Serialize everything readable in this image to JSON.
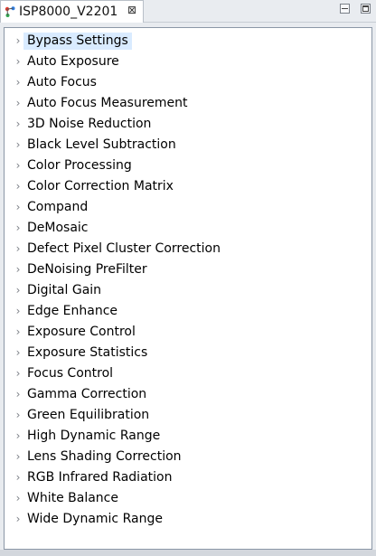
{
  "tab": {
    "title": "ISP8000_V2201",
    "close_glyph": "⊠",
    "icon": "tree-nodes-icon"
  },
  "view_controls": {
    "minimize_icon": "minimize-icon",
    "maximize_icon": "maximize-icon"
  },
  "tree": {
    "selected_index": 0,
    "items": [
      {
        "label": "Bypass Settings"
      },
      {
        "label": "Auto Exposure"
      },
      {
        "label": "Auto Focus"
      },
      {
        "label": "Auto Focus Measurement"
      },
      {
        "label": "3D Noise Reduction"
      },
      {
        "label": "Black Level Subtraction"
      },
      {
        "label": "Color Processing"
      },
      {
        "label": "Color Correction Matrix"
      },
      {
        "label": "Compand"
      },
      {
        "label": "DeMosaic"
      },
      {
        "label": "Defect Pixel Cluster Correction"
      },
      {
        "label": "DeNoising PreFilter"
      },
      {
        "label": "Digital Gain"
      },
      {
        "label": "Edge Enhance"
      },
      {
        "label": "Exposure Control"
      },
      {
        "label": "Exposure Statistics"
      },
      {
        "label": "Focus Control"
      },
      {
        "label": "Gamma Correction"
      },
      {
        "label": "Green Equilibration"
      },
      {
        "label": "High Dynamic Range"
      },
      {
        "label": "Lens Shading Correction"
      },
      {
        "label": "RGB Infrared Radiation"
      },
      {
        "label": "White Balance"
      },
      {
        "label": "Wide Dynamic Range"
      }
    ],
    "twisty_glyph": "›"
  },
  "colors": {
    "selection": "#d9ebff",
    "panel_border": "#8b97a6"
  }
}
